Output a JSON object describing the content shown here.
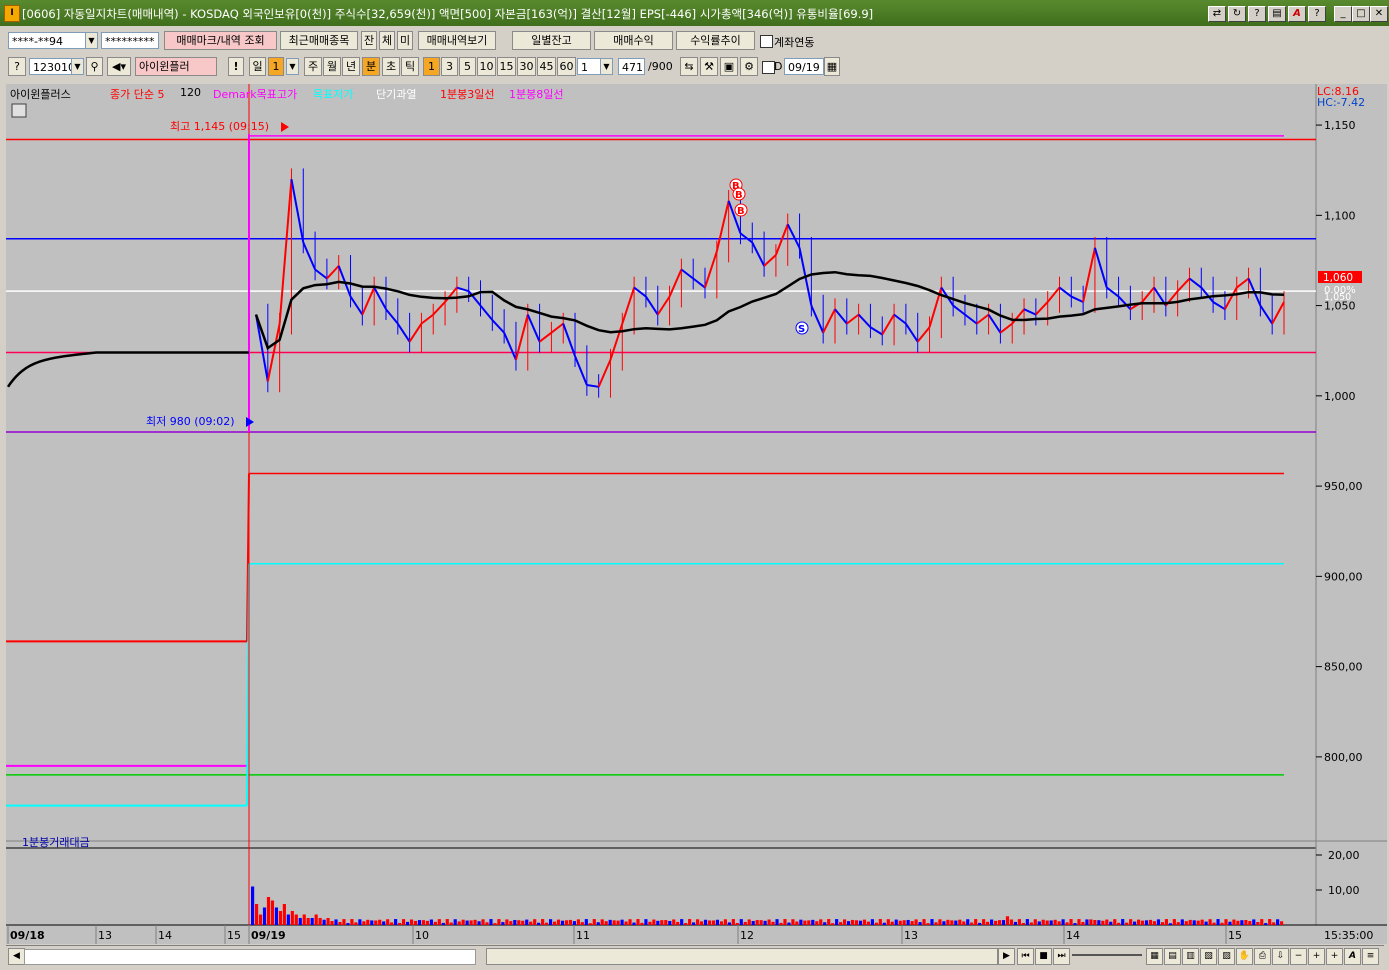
{
  "window": {
    "title": "[0606] 자동일지차트(매매내역) - KOSDAQ 외국인보유[0(천)] 주식수[32,659(천)] 액면[500] 자본금[163(억)] 결산[12월] EPS[-446] 시가총액[346(억)] 유통비율[69.9]",
    "icon_label": "I"
  },
  "toolbar1": {
    "account": "****-**94",
    "password": "*********",
    "mark_query": "매매마크/내역 조회",
    "recent_items": "최근매매종목",
    "btn_jan": "잔",
    "btn_che": "체",
    "btn_mi": "미",
    "trade_history": "매매내역보기",
    "daily_balance": "일별잔고",
    "trade_profit": "매매수익",
    "return_trend": "수익률추이",
    "account_link": "계좌연동"
  },
  "toolbar2": {
    "code": "123010",
    "indicator": "아이윈플러",
    "period_day": "일",
    "period_day_num": "1",
    "period_week": "주",
    "period_month": "월",
    "period_year": "년",
    "period_min": "분",
    "period_sec": "초",
    "period_tick": "틱",
    "minutes": [
      "1",
      "3",
      "5",
      "10",
      "15",
      "30",
      "45",
      "60"
    ],
    "unit": "1",
    "count": "471",
    "count_max": "/900",
    "date_check_label": "D",
    "date": "09/19"
  },
  "legend": {
    "items": [
      {
        "text": "아이윈플러스",
        "color": "#000000"
      },
      {
        "text": "종가 단순 5",
        "color": "#ff0000"
      },
      {
        "text": "120",
        "color": "#000000"
      },
      {
        "text": "Demark목표고가",
        "color": "#ff00ff"
      },
      {
        "text": "목표저가",
        "color": "#00ffff"
      },
      {
        "text": "단기과열",
        "color": "#ffffff"
      },
      {
        "text": "1분봉3일선",
        "color": "#ff0000"
      },
      {
        "text": "1분봉8일선",
        "color": "#ff00ff"
      }
    ],
    "lc": "LC:8.16",
    "hc": "HC:-7.42"
  },
  "annotations": {
    "high": "최고 1,145 (09:15)",
    "low": "최저 980 (09:02)",
    "price_tag": "1,060",
    "pct_tag": "0.00%",
    "pct_tag_under": "1,050",
    "buy_mark": "B",
    "sell_mark": "S"
  },
  "volume_panel": {
    "title": "1분봉거래대금"
  },
  "colors": {
    "chart_bg": "#c0c0c0",
    "up": "#ff0000",
    "down": "#0000ff",
    "ma120": "#000000"
  },
  "chart_data": {
    "type": "candlestick",
    "y_axis_labels": [
      "1,150",
      "1,100",
      "1,050",
      "1,000",
      "950,00",
      "900,00",
      "850,00",
      "800,00"
    ],
    "y_axis_values": [
      1150,
      1100,
      1050,
      1000,
      950,
      900,
      850,
      800
    ],
    "ylim": [
      775,
      1165
    ],
    "volume_axis_labels": [
      "20,00",
      "10,00"
    ],
    "volume_axis_values": [
      20,
      10
    ],
    "x_axis_labels": [
      "09/18",
      "13",
      "14",
      "15",
      "09/19",
      "10",
      "11",
      "12",
      "13",
      "14",
      "15"
    ],
    "time_label": "15:35:00",
    "session_high": 1145,
    "session_low": 980,
    "reference_lines": [
      {
        "name": "demark-high-line",
        "value": 1144,
        "color": "#ff00ff"
      },
      {
        "name": "resistance-line",
        "value": 1142,
        "color": "#ff0000"
      },
      {
        "name": "blue-line",
        "value": 1087,
        "color": "#0000ff"
      },
      {
        "name": "white-line",
        "value": 1058,
        "color": "#ffffff"
      },
      {
        "name": "pink-line",
        "value": 1024,
        "color": "#ff0055"
      },
      {
        "name": "low-line",
        "value": 980,
        "color": "#9400d3"
      },
      {
        "name": "red-step-line",
        "value": 957,
        "color": "#ff0000"
      },
      {
        "name": "cyan-step-line",
        "value": 907,
        "color": "#00ffff"
      },
      {
        "name": "green-line",
        "value": 790,
        "color": "#00cc00"
      }
    ],
    "price_series": [
      1045,
      1008,
      1040,
      1120,
      1085,
      1070,
      1065,
      1072,
      1055,
      1045,
      1060,
      1048,
      1040,
      1030,
      1040,
      1045,
      1052,
      1060,
      1058,
      1050,
      1042,
      1035,
      1020,
      1045,
      1030,
      1035,
      1040,
      1022,
      1006,
      1005,
      1020,
      1040,
      1060,
      1055,
      1045,
      1055,
      1070,
      1065,
      1060,
      1080,
      1108,
      1090,
      1085,
      1072,
      1078,
      1095,
      1082,
      1050,
      1035,
      1048,
      1040,
      1045,
      1038,
      1034,
      1045,
      1040,
      1030,
      1038,
      1060,
      1050,
      1045,
      1040,
      1045,
      1035,
      1040,
      1048,
      1045,
      1052,
      1060,
      1055,
      1052,
      1082,
      1060,
      1055,
      1048,
      1052,
      1060,
      1050,
      1058,
      1065,
      1060,
      1052,
      1048,
      1060,
      1065,
      1050,
      1040,
      1052
    ]
  }
}
